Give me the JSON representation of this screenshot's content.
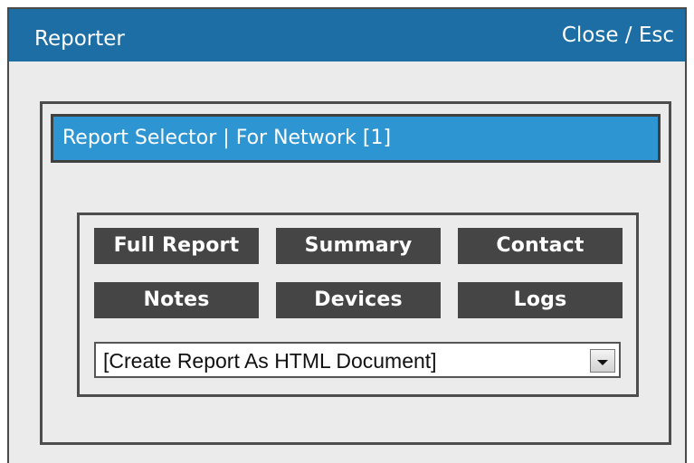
{
  "window": {
    "title": "Reporter",
    "close_label": "Close / Esc"
  },
  "selector": {
    "title": "Report Selector | For Network [1]"
  },
  "report_buttons": {
    "full_report": "Full Report",
    "summary": "Summary",
    "contact": "Contact",
    "notes": "Notes",
    "devices": "Devices",
    "logs": "Logs"
  },
  "format_select": {
    "selected": "[Create Report As HTML Document]"
  },
  "colors": {
    "titlebar": "#1c6ea4",
    "selector_header": "#2d96d2",
    "button": "#454545",
    "panel_background": "#ebebeb"
  },
  "icons": {
    "dropdown": "chevron-down-icon"
  }
}
